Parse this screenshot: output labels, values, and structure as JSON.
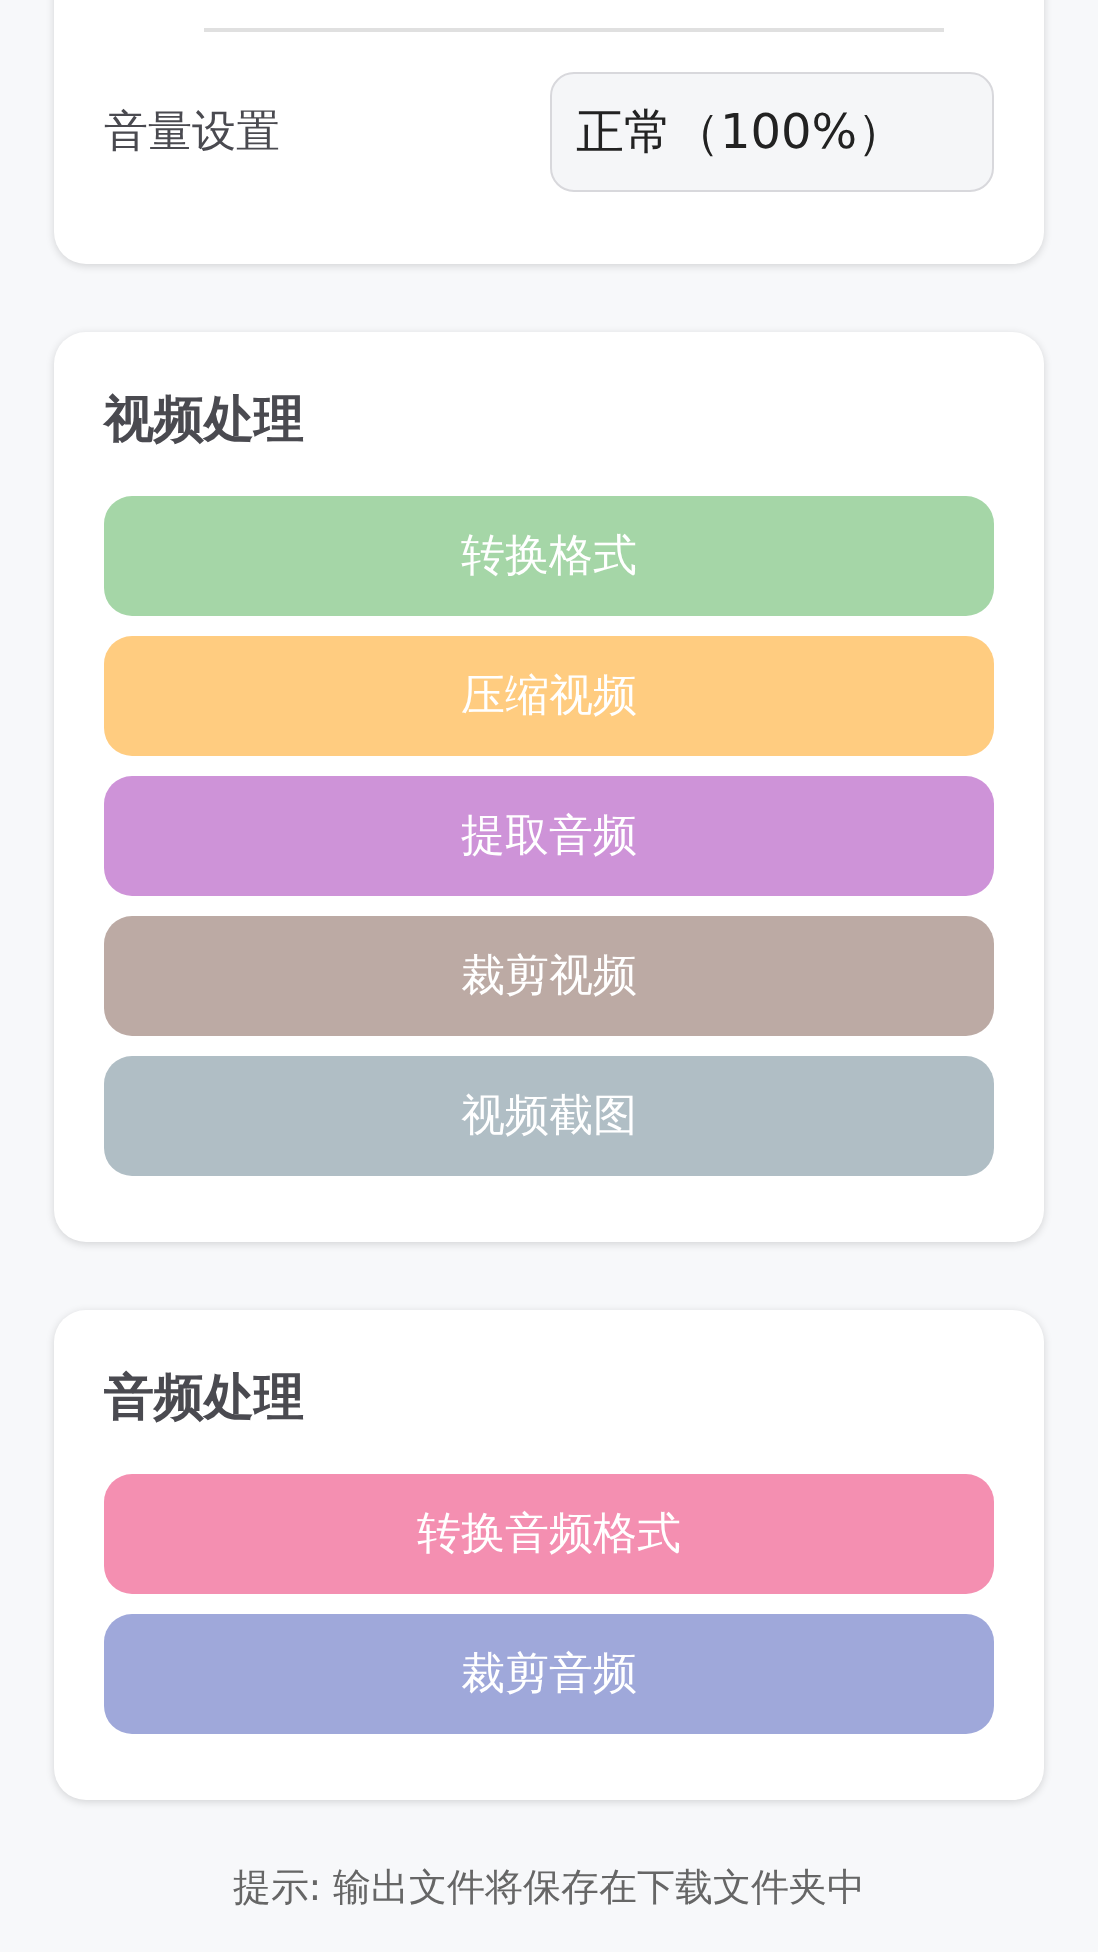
{
  "volume": {
    "label": "音量设置",
    "value": "正常（100%）"
  },
  "sections": [
    {
      "title": "视频处理",
      "buttons": [
        {
          "label": "转换格式",
          "color": "#a5d6a7"
        },
        {
          "label": "压缩视频",
          "color": "#ffcc80"
        },
        {
          "label": "提取音频",
          "color": "#ce93d8"
        },
        {
          "label": "裁剪视频",
          "color": "#bcaaa4"
        },
        {
          "label": "视频截图",
          "color": "#b0bec5"
        }
      ]
    },
    {
      "title": "音频处理",
      "buttons": [
        {
          "label": "转换音频格式",
          "color": "#f48fb1"
        },
        {
          "label": "裁剪音频",
          "color": "#9fa8da"
        }
      ]
    }
  ],
  "hint": "提示: 输出文件将保存在下载文件夹中"
}
